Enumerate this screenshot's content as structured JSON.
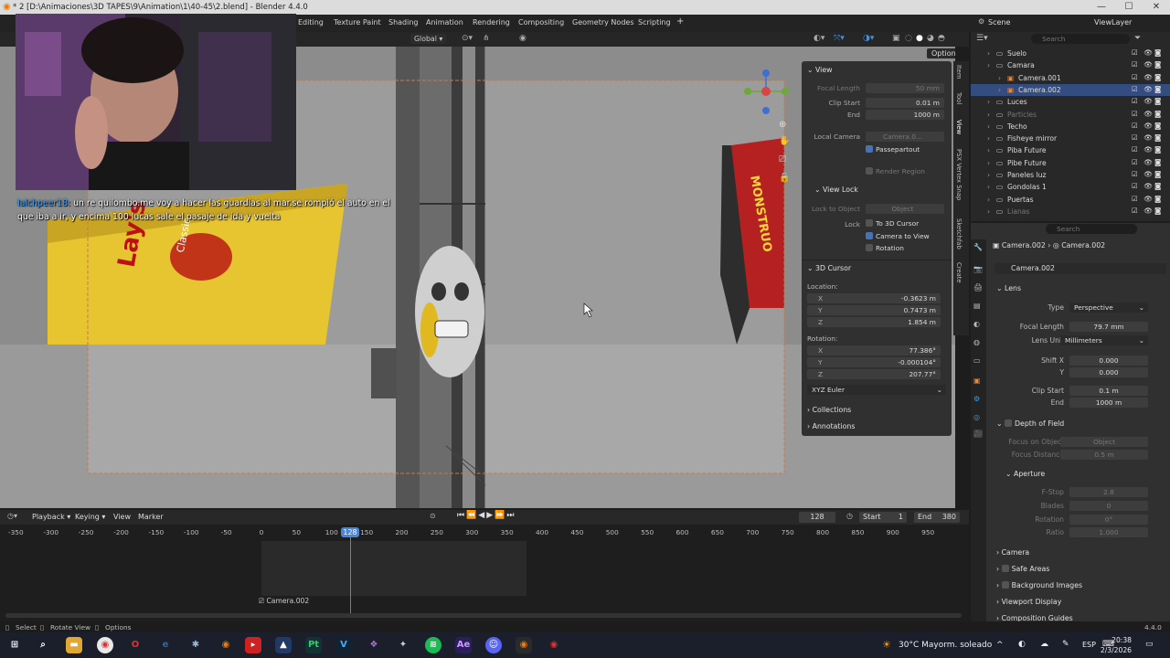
{
  "window": {
    "title": "* 2 [D:\\Animaciones\\3D TAPES\\9\\Animation\\1\\40-45\\2.blend] - Blender 4.4.0",
    "minimize": "—",
    "maximize": "☐",
    "close": "✕"
  },
  "workspaces": [
    "Editing",
    "Texture Paint",
    "Shading",
    "Animation",
    "Rendering",
    "Compositing",
    "Geometry Nodes",
    "Scripting",
    "+"
  ],
  "scene": {
    "label": "Scene",
    "viewlayer": "ViewLayer"
  },
  "viewport_header": {
    "orientation": "Global",
    "options": "Options"
  },
  "n_panel": {
    "view_header": "View",
    "focal_length_label": "Focal Length",
    "focal_length": "50 mm",
    "clip_start_label": "Clip Start",
    "clip_start": "0.01 m",
    "end_label": "End",
    "clip_end": "1000 m",
    "local_camera_label": "Local Camera",
    "local_camera": "Camera.0...",
    "passepartout": "Passepartout",
    "render_region": "Render Region",
    "view_lock_header": "View Lock",
    "lock_to_object_label": "Lock to Object",
    "lock_object": "Object",
    "lock_label": "Lock",
    "to_3d_cursor": "To 3D Cursor",
    "camera_to_view": "Camera to View",
    "rotation": "Rotation",
    "cursor_header": "3D Cursor",
    "location_label": "Location:",
    "loc": [
      {
        "axis": "X",
        "value": "-0.3623 m"
      },
      {
        "axis": "Y",
        "value": "0.7473 m"
      },
      {
        "axis": "Z",
        "value": "1.854 m"
      }
    ],
    "rotation_label": "Rotation:",
    "rot": [
      {
        "axis": "X",
        "value": "77.386°"
      },
      {
        "axis": "Y",
        "value": "-0.000104°"
      },
      {
        "axis": "Z",
        "value": "207.77°"
      }
    ],
    "rot_mode": "XYZ Euler",
    "collections": "Collections",
    "annotations": "Annotations"
  },
  "side_tabs": [
    "Item",
    "Tool",
    "View",
    "PSX Vertex Snap",
    "Sketchfab",
    "Create"
  ],
  "outliner": {
    "search_placeholder": "Search",
    "rows": [
      {
        "name": "Suelo",
        "indent": 0,
        "sel": false,
        "dim": false
      },
      {
        "name": "Camara",
        "indent": 0,
        "sel": false,
        "dim": false
      },
      {
        "name": "Camera.001",
        "indent": 1,
        "sel": false,
        "dim": false
      },
      {
        "name": "Camera.002",
        "indent": 1,
        "sel": true,
        "dim": false
      },
      {
        "name": "Luces",
        "indent": 0,
        "sel": false,
        "dim": false
      },
      {
        "name": "Particles",
        "indent": 0,
        "sel": false,
        "dim": true
      },
      {
        "name": "Techo",
        "indent": 0,
        "sel": false,
        "dim": false
      },
      {
        "name": "Fisheye mirror",
        "indent": 0,
        "sel": false,
        "dim": false
      },
      {
        "name": "Piba Future",
        "indent": 0,
        "sel": false,
        "dim": false
      },
      {
        "name": "Pibe Future",
        "indent": 0,
        "sel": false,
        "dim": false
      },
      {
        "name": "Paneles luz",
        "indent": 0,
        "sel": false,
        "dim": false
      },
      {
        "name": "Gondolas 1",
        "indent": 0,
        "sel": false,
        "dim": false
      },
      {
        "name": "Puertas",
        "indent": 0,
        "sel": false,
        "dim": false
      },
      {
        "name": "Lianas",
        "indent": 0,
        "sel": false,
        "dim": true
      }
    ]
  },
  "properties": {
    "search_placeholder": "Search",
    "breadcrumb_obj": "Camera.002",
    "breadcrumb_data": "Camera.002",
    "datablock": "Camera.002",
    "lens_header": "Lens",
    "type_label": "Type",
    "type": "Perspective",
    "focal_label": "Focal Length",
    "focal": "79.7 mm",
    "lens_unit_label": "Lens Unit",
    "lens_unit": "Millimeters",
    "shift_x_label": "Shift X",
    "shift_x": "0.000",
    "shift_y_label": "Y",
    "shift_y": "0.000",
    "clip_start_label": "Clip Start",
    "clip_start": "0.1 m",
    "clip_end_label": "End",
    "clip_end": "1000 m",
    "dof_header": "Depth of Field",
    "focus_obj_label": "Focus on Object",
    "focus_obj": "Object",
    "focus_dist_label": "Focus Distance",
    "focus_dist": "0.5 m",
    "aperture_header": "Aperture",
    "fstop_label": "F-Stop",
    "fstop": "2.8",
    "blades_label": "Blades",
    "blades": "0",
    "ap_rot_label": "Rotation",
    "ap_rot": "0°",
    "ratio_label": "Ratio",
    "ratio": "1.000",
    "sections": [
      "Camera",
      "Safe Areas",
      "Background Images",
      "Viewport Display",
      "Composition Guides"
    ]
  },
  "timeline": {
    "menus": [
      "Playback",
      "Keying",
      "View",
      "Marker"
    ],
    "current_frame": "128",
    "start_label": "Start",
    "start": "1",
    "end_label": "End",
    "end": "380",
    "ticks": [
      "-350",
      "-300",
      "-250",
      "-200",
      "-150",
      "-100",
      "-50",
      "0",
      "50",
      "100",
      "150",
      "200",
      "250",
      "300",
      "350",
      "400",
      "450",
      "500",
      "550",
      "600",
      "650",
      "700",
      "750",
      "800",
      "850",
      "900",
      "950"
    ],
    "track_label": "Camera.002"
  },
  "status": {
    "select": "Select",
    "rotate_view": "Rotate View",
    "options": "Options",
    "version": "4.4.0"
  },
  "stream": {
    "chat_user": "Ialchpeer18:",
    "chat_line1": "un re quilombo.me voy a hacer las guardias al mar.se rompió el auto en el",
    "chat_line2": "que iba a ir, y encima 100 lucas sale el pasaje de ida y vuelta"
  },
  "scene_text": {
    "chips_logo": "Lay's",
    "chips_side": "Classic",
    "cereal": "MONSTRUO"
  },
  "taskbar": {
    "weather": "30°C  Mayorm. soleado",
    "lang": "ESP",
    "time": "20:38",
    "date": "2/3/2026"
  }
}
